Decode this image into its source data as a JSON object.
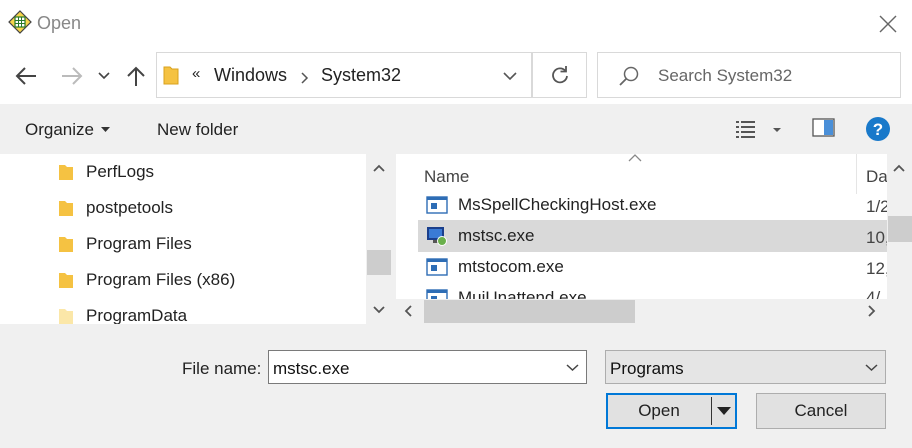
{
  "window": {
    "title": "Open"
  },
  "address": {
    "overflow": "«",
    "crumbs": [
      "Windows",
      "System32"
    ]
  },
  "search": {
    "placeholder": "Search System32"
  },
  "toolbar": {
    "organize": "Organize",
    "new_folder": "New folder"
  },
  "tree": {
    "items": [
      "PerfLogs",
      "postpetools",
      "Program Files",
      "Program Files (x86)",
      "ProgramData"
    ]
  },
  "files": {
    "columns": {
      "name": "Name",
      "date": "Da"
    },
    "rows": [
      {
        "name": "MsSpellCheckingHost.exe",
        "date": "1/2",
        "selected": false
      },
      {
        "name": "mstsc.exe",
        "date": "10,",
        "selected": true
      },
      {
        "name": "mtstocom.exe",
        "date": "12,",
        "selected": false
      },
      {
        "name": "MuiUnattend.exe",
        "date": "4/",
        "selected": false
      }
    ]
  },
  "footer": {
    "file_name_label": "File name:",
    "file_name_value": "mstsc.exe",
    "file_type_value": "Programs",
    "open_label": "Open",
    "cancel_label": "Cancel"
  },
  "colors": {
    "selection": "#d9d9d9",
    "help_blue": "#1979ca",
    "folder": "#f5c242"
  }
}
